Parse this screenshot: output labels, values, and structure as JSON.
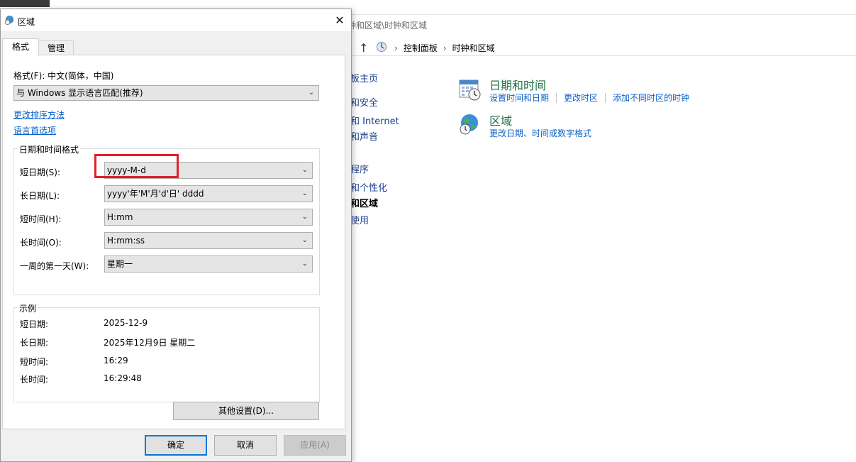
{
  "background_window": {
    "path_fragment": "钟和区域\\时钟和区域",
    "breadcrumb": [
      "控制面板",
      "时钟和区域"
    ],
    "sidebar_fragments": [
      "板主页",
      "和安全",
      "和 Internet",
      "和声音",
      "",
      "程序",
      "和个性化",
      "和区域",
      "使用"
    ],
    "categories": [
      {
        "title": "日期和时间",
        "links": [
          "设置时间和日期",
          "更改时区",
          "添加不同时区的时钟"
        ]
      },
      {
        "title": "区域",
        "links": [
          "更改日期、时间或数字格式"
        ]
      }
    ]
  },
  "dialog": {
    "title": "区域",
    "tabs": [
      "格式",
      "管理"
    ],
    "format_label": "格式(F): 中文(简体，中国)",
    "format_value": "与 Windows 显示语言匹配(推荐)",
    "links": [
      "更改排序方法",
      "语言首选项"
    ],
    "datetime_group_title": "日期和时间格式",
    "fields": [
      {
        "label": "短日期(S):",
        "value": "yyyy-M-d"
      },
      {
        "label": "长日期(L):",
        "value": "yyyy'年'M'月'd'日' dddd"
      },
      {
        "label": "短时间(H):",
        "value": "H:mm"
      },
      {
        "label": "长时间(O):",
        "value": "H:mm:ss"
      },
      {
        "label": "一周的第一天(W):",
        "value": "星期一"
      }
    ],
    "example_group_title": "示例",
    "examples": [
      {
        "label": "短日期:",
        "value": "2025-12-9"
      },
      {
        "label": "长日期:",
        "value": "2025年12月9日 星期二"
      },
      {
        "label": "短时间:",
        "value": "16:29"
      },
      {
        "label": "长时间:",
        "value": "16:29:48"
      }
    ],
    "other_settings": "其他设置(D)...",
    "buttons": {
      "ok": "确定",
      "cancel": "取消",
      "apply": "应用(A)"
    }
  },
  "colors": {
    "highlight": "#e0202a",
    "link": "#0a62c8",
    "category_title": "#1e7145",
    "primary_border": "#0078d7"
  },
  "icons": [
    "globe-clock-icon",
    "calendar-clock-icon",
    "control-panel-icon",
    "up-arrow-icon",
    "close-icon",
    "chevron-down-icon"
  ]
}
